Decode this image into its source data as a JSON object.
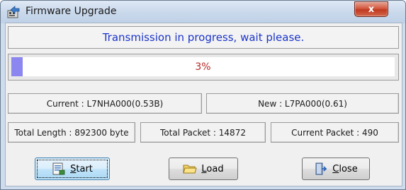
{
  "window": {
    "title": "Firmware Upgrade",
    "close_glyph": "x"
  },
  "status": {
    "message": "Transmission in progress, wait please.",
    "color": "#1b34c9"
  },
  "progress": {
    "percent_text": "3%",
    "fraction": 0.03,
    "fill_color": "#8b86f0",
    "text_color": "#b82828"
  },
  "versions": {
    "current": "Current : L7NHA000(0.53B)",
    "new": "New : L7PA000(0.61)"
  },
  "stats": {
    "total_length": "Total Length : 892300 byte",
    "total_packet": "Total Packet : 14872",
    "current_packet": "Current Packet : 490"
  },
  "buttons": {
    "start": {
      "underline": "S",
      "rest": "tart",
      "icon": "start-icon"
    },
    "load": {
      "underline": "L",
      "rest": "oad",
      "icon": "folder-open-icon"
    },
    "close": {
      "underline": "C",
      "rest": "lose",
      "icon": "exit-door-icon"
    }
  }
}
